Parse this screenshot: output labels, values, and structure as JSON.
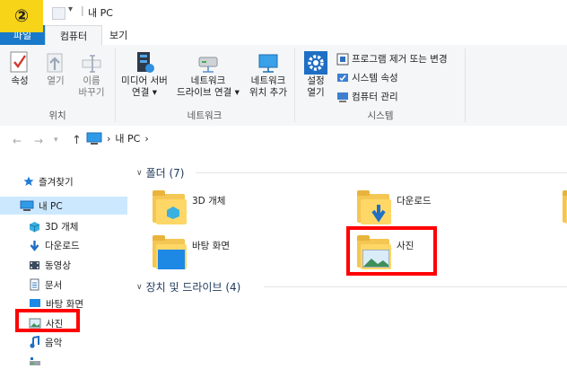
{
  "step_badge": "②",
  "title": {
    "separator": "|",
    "path": "내 PC",
    "dropdown": "▾"
  },
  "tabs": {
    "file": "파일",
    "computer": "컴퓨터",
    "view": "보기"
  },
  "ribbon": {
    "location": {
      "properties": "속성",
      "open": "열기",
      "rename_line1": "이름",
      "rename_line2": "바꾸기",
      "group": "위치"
    },
    "network": {
      "media_line1": "미디어 서버",
      "media_line2": "연결 ▾",
      "map_line1": "네트워크",
      "map_line2": "드라이브 연결 ▾",
      "add_line1": "네트워크",
      "add_line2": "위치 추가",
      "group": "네트워크"
    },
    "system": {
      "settings_line1": "설정",
      "settings_line2": "열기",
      "uninstall": "프로그램 제거 또는 변경",
      "sysprops": "시스템 속성",
      "manage": "컴퓨터 관리",
      "group": "시스템"
    }
  },
  "nav": {
    "back": "←",
    "forward": "→",
    "recent": "▾",
    "up": "↑",
    "crumb_sep": "›",
    "crumb": "내 PC",
    "crumb_end": "›"
  },
  "sidebar": {
    "quick": "즐겨찾기",
    "thispc": "내 PC",
    "objects3d": "3D 개체",
    "downloads": "다운로드",
    "videos": "동영상",
    "documents": "문서",
    "desktop": "바탕 화면",
    "pictures": "사진",
    "music": "음악"
  },
  "main": {
    "folders_header": "폴더 (7)",
    "devices_header": "장치 및 드라이브 (4)",
    "folders": [
      "3D 개체",
      "다운로드",
      "바탕 화면",
      "사진"
    ]
  },
  "colors": {
    "accent": "#1979ca",
    "highlight": "#ff0000",
    "badge": "#f7d417",
    "selected": "#cce8ff"
  }
}
